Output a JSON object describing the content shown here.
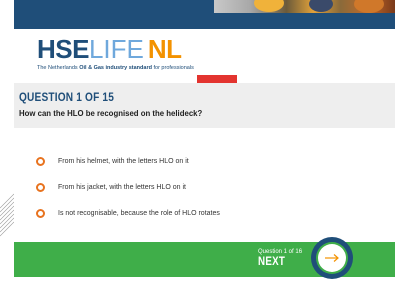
{
  "logo": {
    "hse": "HSE",
    "life": "LIFE",
    "nl": "NL",
    "tagline_prefix": "The Netherlands ",
    "tagline_bold": "Oil & Gas industry standard",
    "tagline_suffix": " for professionals"
  },
  "question": {
    "title": "QUESTION 1 OF 15",
    "text": "How can the HLO be recognised on the helideck?"
  },
  "options": [
    {
      "label": "From his helmet, with the letters HLO on it"
    },
    {
      "label": "From his jacket, with the letters HLO on it"
    },
    {
      "label": "Is not recognisable, because the role of HLO rotates"
    }
  ],
  "footer": {
    "counter": "Question 1 of 16",
    "next_label": "NEXT"
  },
  "colors": {
    "navy": "#1f4e79",
    "orange": "#f39200",
    "radio_orange": "#e8731f",
    "green": "#3fae49",
    "light_blue": "#6fa8dc"
  },
  "icons": {
    "next_button": "arrow-right-icon",
    "option_marker": "radio-circle-icon"
  }
}
